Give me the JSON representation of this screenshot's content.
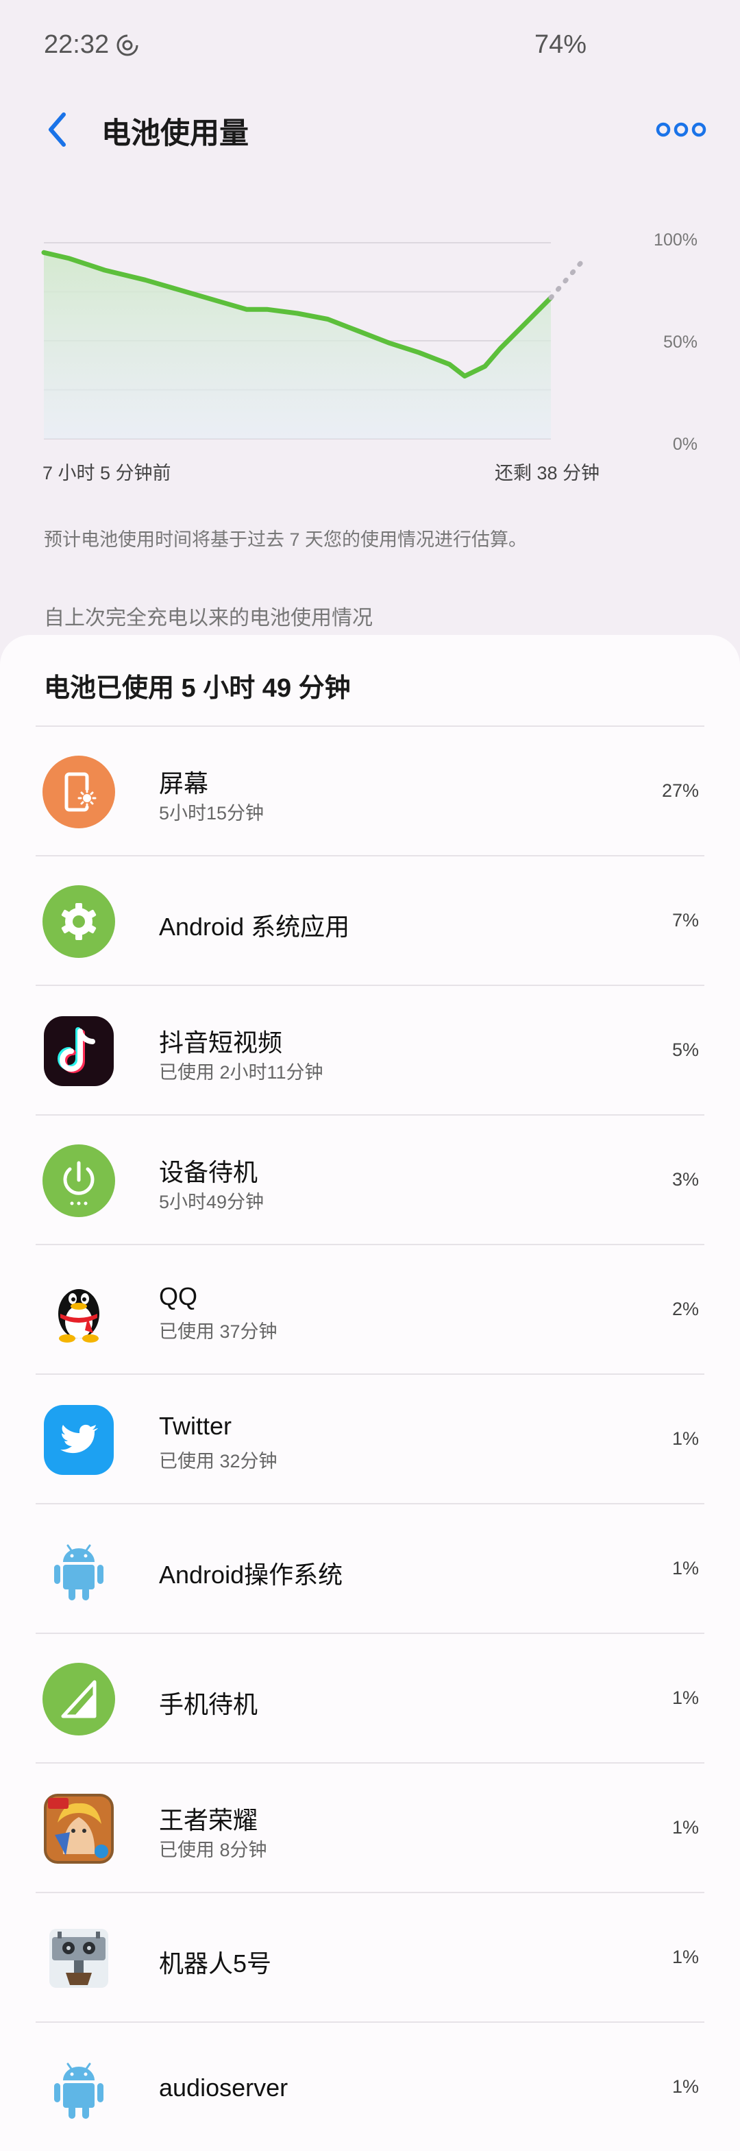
{
  "status_bar": {
    "time": "22:32",
    "battery": "74%"
  },
  "app_bar": {
    "title": "电池使用量"
  },
  "chart_data": {
    "type": "area",
    "x_start_label": "7 小时 5 分钟前",
    "x_end_label": "还剩 38 分钟",
    "y_tick_labels": [
      "100%",
      "50%",
      "0%"
    ],
    "ylim": [
      0,
      100
    ],
    "series": [
      {
        "values": [
          [
            0,
            95
          ],
          [
            0.05,
            92
          ],
          [
            0.12,
            86
          ],
          [
            0.2,
            81
          ],
          [
            0.28,
            75
          ],
          [
            0.36,
            69
          ],
          [
            0.4,
            66
          ],
          [
            0.44,
            66
          ],
          [
            0.5,
            64
          ],
          [
            0.56,
            61
          ],
          [
            0.62,
            55
          ],
          [
            0.68,
            49
          ],
          [
            0.74,
            44
          ],
          [
            0.8,
            38
          ],
          [
            0.83,
            32
          ],
          [
            0.87,
            37
          ],
          [
            0.9,
            46
          ],
          [
            0.95,
            59
          ],
          [
            1.0,
            72
          ]
        ]
      },
      {
        "projected": true,
        "values": [
          [
            1.0,
            72
          ],
          [
            1.07,
            93
          ]
        ]
      }
    ],
    "grid": true,
    "color": "#5cbf3b"
  },
  "estimate_note": "预计电池使用时间将基于过去 7 天您的使用情况进行估算。",
  "section_header": "自上次完全充电以来的电池使用情况",
  "usage_total": "电池已使用 5 小时 49 分钟",
  "apps": [
    {
      "name": "屏幕",
      "sub": "5小时15分钟",
      "percent": "27%",
      "icon": "screen-icon"
    },
    {
      "name": "Android 系统应用",
      "sub": "",
      "percent": "7%",
      "icon": "android-system-apps-icon"
    },
    {
      "name": "抖音短视频",
      "sub": "已使用 2小时11分钟",
      "percent": "5%",
      "icon": "douyin-icon"
    },
    {
      "name": "设备待机",
      "sub": "5小时49分钟",
      "percent": "3%",
      "icon": "device-idle-icon"
    },
    {
      "name": "QQ",
      "sub": "已使用 37分钟",
      "percent": "2%",
      "icon": "qq-icon"
    },
    {
      "name": "Twitter",
      "sub": "已使用 32分钟",
      "percent": "1%",
      "icon": "twitter-icon"
    },
    {
      "name": "Android操作系统",
      "sub": "",
      "percent": "1%",
      "icon": "android-os-icon"
    },
    {
      "name": "手机待机",
      "sub": "",
      "percent": "1%",
      "icon": "phone-idle-icon"
    },
    {
      "name": "王者荣耀",
      "sub": "已使用 8分钟",
      "percent": "1%",
      "icon": "honor-of-kings-icon"
    },
    {
      "name": "机器人5号",
      "sub": "",
      "percent": "1%",
      "icon": "robot-5-icon"
    },
    {
      "name": "audioserver",
      "sub": "",
      "percent": "1%",
      "icon": "audioserver-icon"
    }
  ]
}
